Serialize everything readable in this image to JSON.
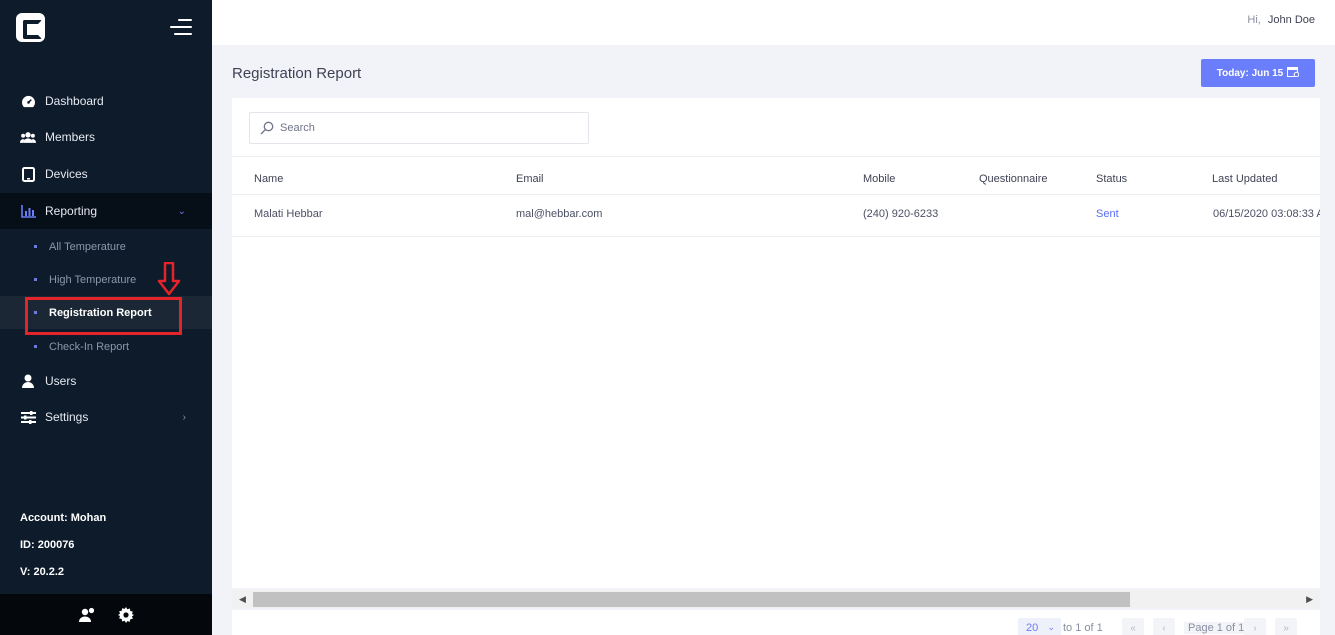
{
  "sidebar": {
    "nav": [
      {
        "label": "Dashboard",
        "icon": "dashboard-gauge-icon"
      },
      {
        "label": "Members",
        "icon": "members-icon"
      },
      {
        "label": "Devices",
        "icon": "tablet-icon"
      },
      {
        "label": "Reporting",
        "icon": "bar-chart-icon"
      },
      {
        "label": "Users",
        "icon": "user-icon"
      },
      {
        "label": "Settings",
        "icon": "sliders-icon"
      }
    ],
    "reporting_sub": [
      {
        "label": "All Temperature"
      },
      {
        "label": "High Temperature"
      },
      {
        "label": "Registration Report"
      },
      {
        "label": "Check-In Report"
      }
    ],
    "account": "Account: Mohan",
    "id": "ID: 200076",
    "version": "V: 20.2.2"
  },
  "header": {
    "greeting": "Hi,",
    "username": "John Doe"
  },
  "page": {
    "title": "Registration Report",
    "date_button": "Today: Jun 15"
  },
  "search": {
    "placeholder": "Search"
  },
  "table": {
    "columns": [
      "Name",
      "Email",
      "Mobile",
      "Questionnaire",
      "Status",
      "Last Updated"
    ],
    "rows": [
      {
        "name": "Malati Hebbar",
        "email": "mal@hebbar.com",
        "mobile": "(240) 920-6233",
        "questionnaire": "",
        "status": "Sent",
        "last_updated": "06/15/2020 03:08:33 A"
      }
    ]
  },
  "pagination": {
    "page_size": "20",
    "range": "to 1 of 1",
    "page_label": "Page 1 of 1"
  },
  "colors": {
    "sidebar_bg": "#0d1b2a",
    "accent": "#6a7dfa",
    "highlight": "#e5232a"
  }
}
